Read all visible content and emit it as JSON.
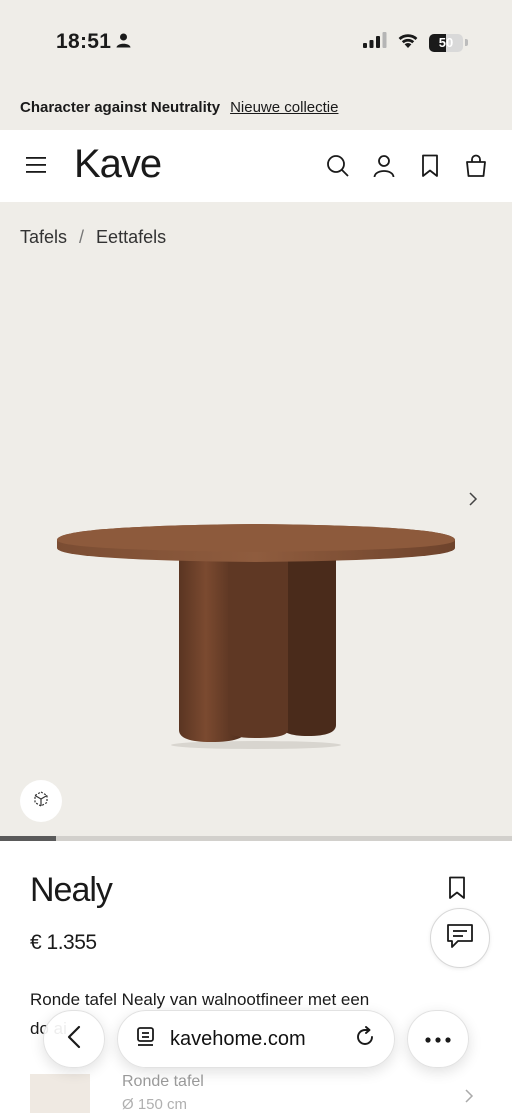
{
  "status_bar": {
    "time": "18:51",
    "battery": "50",
    "battery_level": 0.5,
    "icons": [
      "person-icon",
      "signal-icon",
      "wifi-icon",
      "battery-icon"
    ]
  },
  "promo": {
    "text": "Character against Neutrality",
    "link": "Nieuwe collectie"
  },
  "header": {
    "logo": "Kave",
    "icons": [
      "menu-icon",
      "search-icon",
      "account-icon",
      "bookmark-icon",
      "bag-icon"
    ]
  },
  "breadcrumb": {
    "items": [
      "Tafels",
      "Eettafels"
    ],
    "separator": "/"
  },
  "gallery": {
    "progress": 0.11,
    "icons": [
      "chevron-right-icon",
      "view-3d-icon"
    ]
  },
  "product": {
    "name": "Nealy",
    "price": "€ 1.355",
    "description": "Ronde tafel Nealy van walnootfineer met een",
    "description_line2": "do     ai",
    "variant": {
      "title": "Ronde tafel",
      "size": "Ø 150 cm"
    }
  },
  "browser": {
    "url": "kavehome.com",
    "icons": [
      "back-icon",
      "tabs-icon",
      "reload-icon",
      "more-icon"
    ]
  },
  "colors": {
    "background": "#efede8",
    "wood": "#7a4a30"
  }
}
